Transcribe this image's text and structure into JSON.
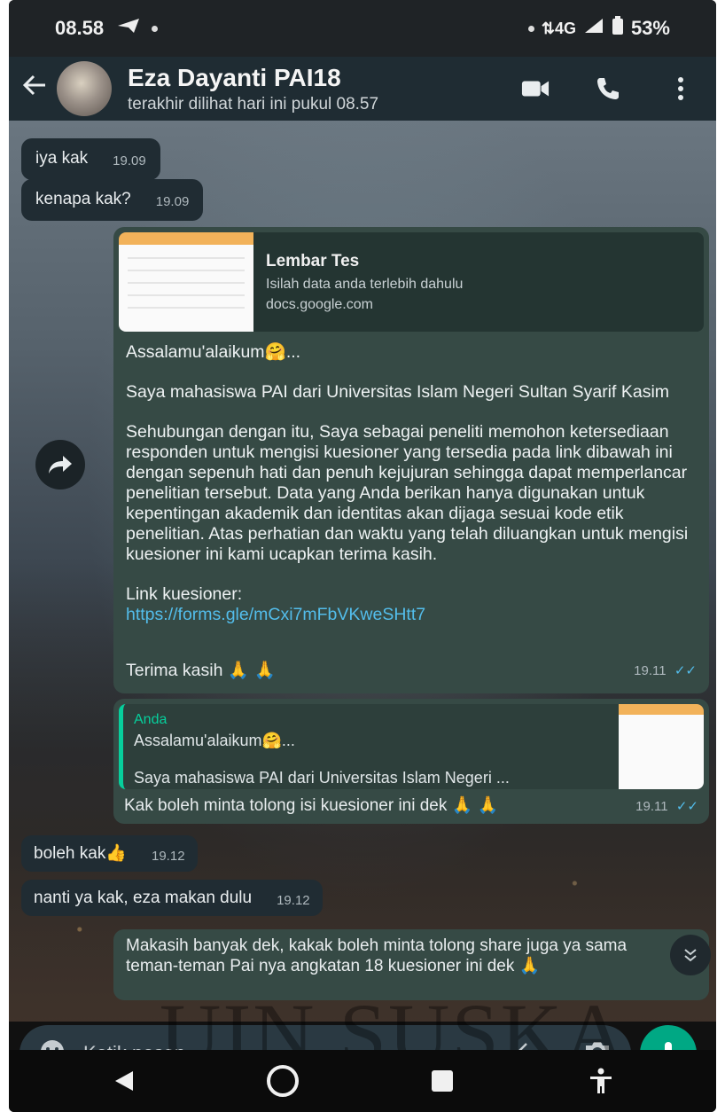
{
  "status_bar": {
    "time": "08.58",
    "network": "4G",
    "battery": "53%"
  },
  "header": {
    "contact_name": "Eza Dayanti PAI18",
    "last_seen": "terakhir dilihat hari ini pukul 08.57"
  },
  "messages": [
    {
      "direction": "in",
      "text": "iya kak",
      "time": "19.09"
    },
    {
      "direction": "in",
      "text": "kenapa kak?",
      "time": "19.09"
    }
  ],
  "forwarded_message": {
    "link_preview": {
      "title": "Lembar Tes",
      "description": "Isilah data anda terlebih dahulu",
      "domain": "docs.google.com"
    },
    "paragraphs": [
      "Assalamu'alaikum🤗...",
      "Saya mahasiswa PAI dari Universitas Islam Negeri Sultan Syarif Kasim",
      "Sehubungan dengan itu, Saya sebagai peneliti memohon ketersediaan responden untuk mengisi kuesioner yang tersedia pada link dibawah ini dengan sepenuh hati dan penuh kejujuran sehingga dapat memperlancar penelitian tersebut. Data yang Anda berikan hanya digunakan untuk kepentingan akademik dan identitas akan dijaga sesuai kode etik penelitian. Atas perhatian dan waktu yang telah diluangkan untuk mengisi kuesioner ini kami ucapkan terima kasih."
    ],
    "link_label": "Link kuesioner:",
    "link_url": "https://forms.gle/mCxi7mFbVKweSHtt7",
    "closing": "Terima kasih 🙏 🙏",
    "time": "19.11"
  },
  "reply_message": {
    "quote_author": "Anda",
    "quote_line1": "Assalamu'alaikum🤗...",
    "quote_line2": "Saya mahasiswa PAI dari Universitas Islam Negeri ...",
    "text": "Kak boleh minta tolong isi kuesioner ini dek 🙏 🙏",
    "time": "19.11"
  },
  "later_messages": [
    {
      "direction": "in",
      "text": "boleh kak👍",
      "time": "19.12"
    },
    {
      "direction": "in",
      "text": "nanti ya kak, eza makan dulu",
      "time": "19.12"
    }
  ],
  "last_message": {
    "text": "Makasih banyak dek, kakak boleh minta tolong share juga ya sama teman-teman Pai nya angkatan 18 kuesioner ini dek 🙏"
  },
  "input": {
    "placeholder": "Ketik pesan"
  },
  "watermark": "UIN SUSKA",
  "colors": {
    "outgoing_bubble": "#364a45",
    "incoming_bubble": "#202c33",
    "accent": "#00a884",
    "link": "#53bdeb"
  }
}
